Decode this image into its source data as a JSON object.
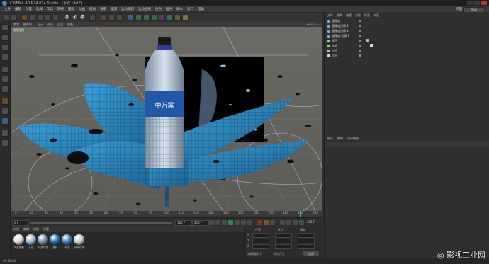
{
  "window": {
    "title": "CINEMA 4D R14.014 Studio - [水花.c4d *]"
  },
  "menubar": {
    "items": [
      "文件",
      "编辑",
      "创建",
      "选择",
      "工具",
      "网格",
      "捕捉",
      "动画",
      "模拟",
      "渲染",
      "雕刻",
      "运动跟踪",
      "运动图形",
      "角色",
      "插件",
      "脚本",
      "窗口",
      "帮助"
    ],
    "layout_label": "界面",
    "layout_value": "启动"
  },
  "toolbar": {
    "axis_letters": [
      "X",
      "Y",
      "Z"
    ]
  },
  "viewport": {
    "menu": [
      "查看",
      "摄像机",
      "显示",
      "选项",
      "过滤",
      "面板"
    ],
    "label": "透视视图"
  },
  "timeline": {
    "ticks": [
      "0",
      "10",
      "20",
      "30",
      "40",
      "50",
      "60",
      "70",
      "80",
      "90",
      "100",
      "110",
      "120",
      "130",
      "140",
      "150",
      "160",
      "170",
      "180",
      "190",
      "200"
    ],
    "start_field": "0 F",
    "current_field": "160 F",
    "end_field": "200 F",
    "frame_readout": "205 F"
  },
  "materials": {
    "menu": [
      "创建",
      "编辑",
      "功能",
      "纹理"
    ],
    "items": [
      {
        "label": "汽性塑料",
        "color": "#d8d8d8"
      },
      {
        "label": "水纹",
        "color": "#9bb7d4"
      },
      {
        "label": "材质材质",
        "color": "#6f8fb0"
      },
      {
        "label": "塑料",
        "color": "#1f6fb8"
      },
      {
        "label": "材质",
        "color": "#3b7fd0"
      },
      {
        "label": "外用材质",
        "color": "#c8d0d8"
      }
    ]
  },
  "coordinates": {
    "rows": [
      "X",
      "Y",
      "Z"
    ],
    "headers": [
      "位置",
      "尺寸",
      "旋转"
    ],
    "values": [
      "0 cm",
      "0 cm",
      "0 °"
    ],
    "mode_left": "对象(相对)",
    "mode_right": "绝对尺寸",
    "apply": "应用"
  },
  "object_manager": {
    "menu": [
      "文件",
      "编辑",
      "查看",
      "对象",
      "标签",
      "书签"
    ],
    "objects": [
      {
        "name": "摄像机",
        "color": "#7aa6d8"
      },
      {
        "name": "摄像机目标.1",
        "color": "#7aa6d8"
      },
      {
        "name": "摄像机目标.1",
        "color": "#7aa6d8"
      },
      {
        "name": "摄像机.目标.1",
        "color": "#7aa6d8"
      },
      {
        "name": "瓶子",
        "color": "#9fd07a"
      },
      {
        "name": "花瓣",
        "color": "#9fd07a"
      },
      {
        "name": "粒子",
        "color": "#d8c07a"
      },
      {
        "name": "灯光",
        "color": "#e0e0e0"
      }
    ]
  },
  "attribute_manager": {
    "menu": [
      "模式",
      "编辑",
      "用户数据"
    ]
  },
  "status": {
    "text": "00:00:04"
  },
  "watermark": {
    "text": "影视工业网"
  }
}
